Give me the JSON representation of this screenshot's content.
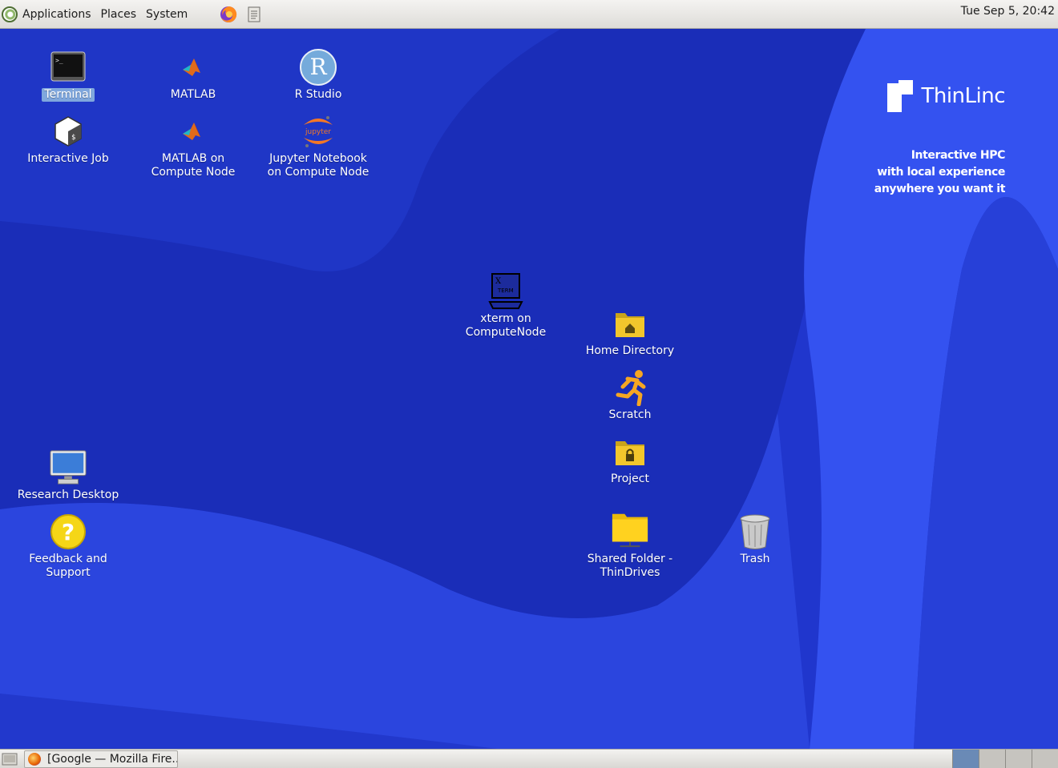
{
  "top_panel": {
    "menus": [
      "Applications",
      "Places",
      "System"
    ],
    "clock": "Tue Sep  5, 20:42"
  },
  "desktop": {
    "icons": [
      {
        "label": "Terminal",
        "icon": "terminal-icon",
        "selected": true
      },
      {
        "label": "MATLAB",
        "icon": "matlab-icon"
      },
      {
        "label": "R Studio",
        "icon": "rstudio-icon"
      },
      {
        "label": "Interactive Job",
        "icon": "interactive-job-icon"
      },
      {
        "label": "MATLAB on\nCompute Node",
        "icon": "matlab-icon"
      },
      {
        "label": "Jupyter Notebook\non Compute Node",
        "icon": "jupyter-icon"
      },
      {
        "label": "xterm on\nComputeNode",
        "icon": "xterm-icon"
      },
      {
        "label": "Home Directory",
        "icon": "home-folder-icon"
      },
      {
        "label": "Scratch",
        "icon": "running-man-icon"
      },
      {
        "label": "Project",
        "icon": "locked-folder-icon"
      },
      {
        "label": "Research Desktop",
        "icon": "monitor-icon"
      },
      {
        "label": "Feedback and\nSupport",
        "icon": "help-icon"
      },
      {
        "label": "Shared Folder -\nThinDrives",
        "icon": "shared-folder-icon"
      },
      {
        "label": "Trash",
        "icon": "trash-icon"
      }
    ]
  },
  "branding": {
    "name": "ThinLinc",
    "tagline": [
      "Interactive HPC",
      "with local experience",
      "anywhere you want it"
    ]
  },
  "bottom_panel": {
    "task": "[Google — Mozilla Fire..."
  },
  "colors": {
    "desktop_dark": "#1a2bb3",
    "desktop_light": "#2d44e0",
    "selection": "#7fa7dd"
  }
}
